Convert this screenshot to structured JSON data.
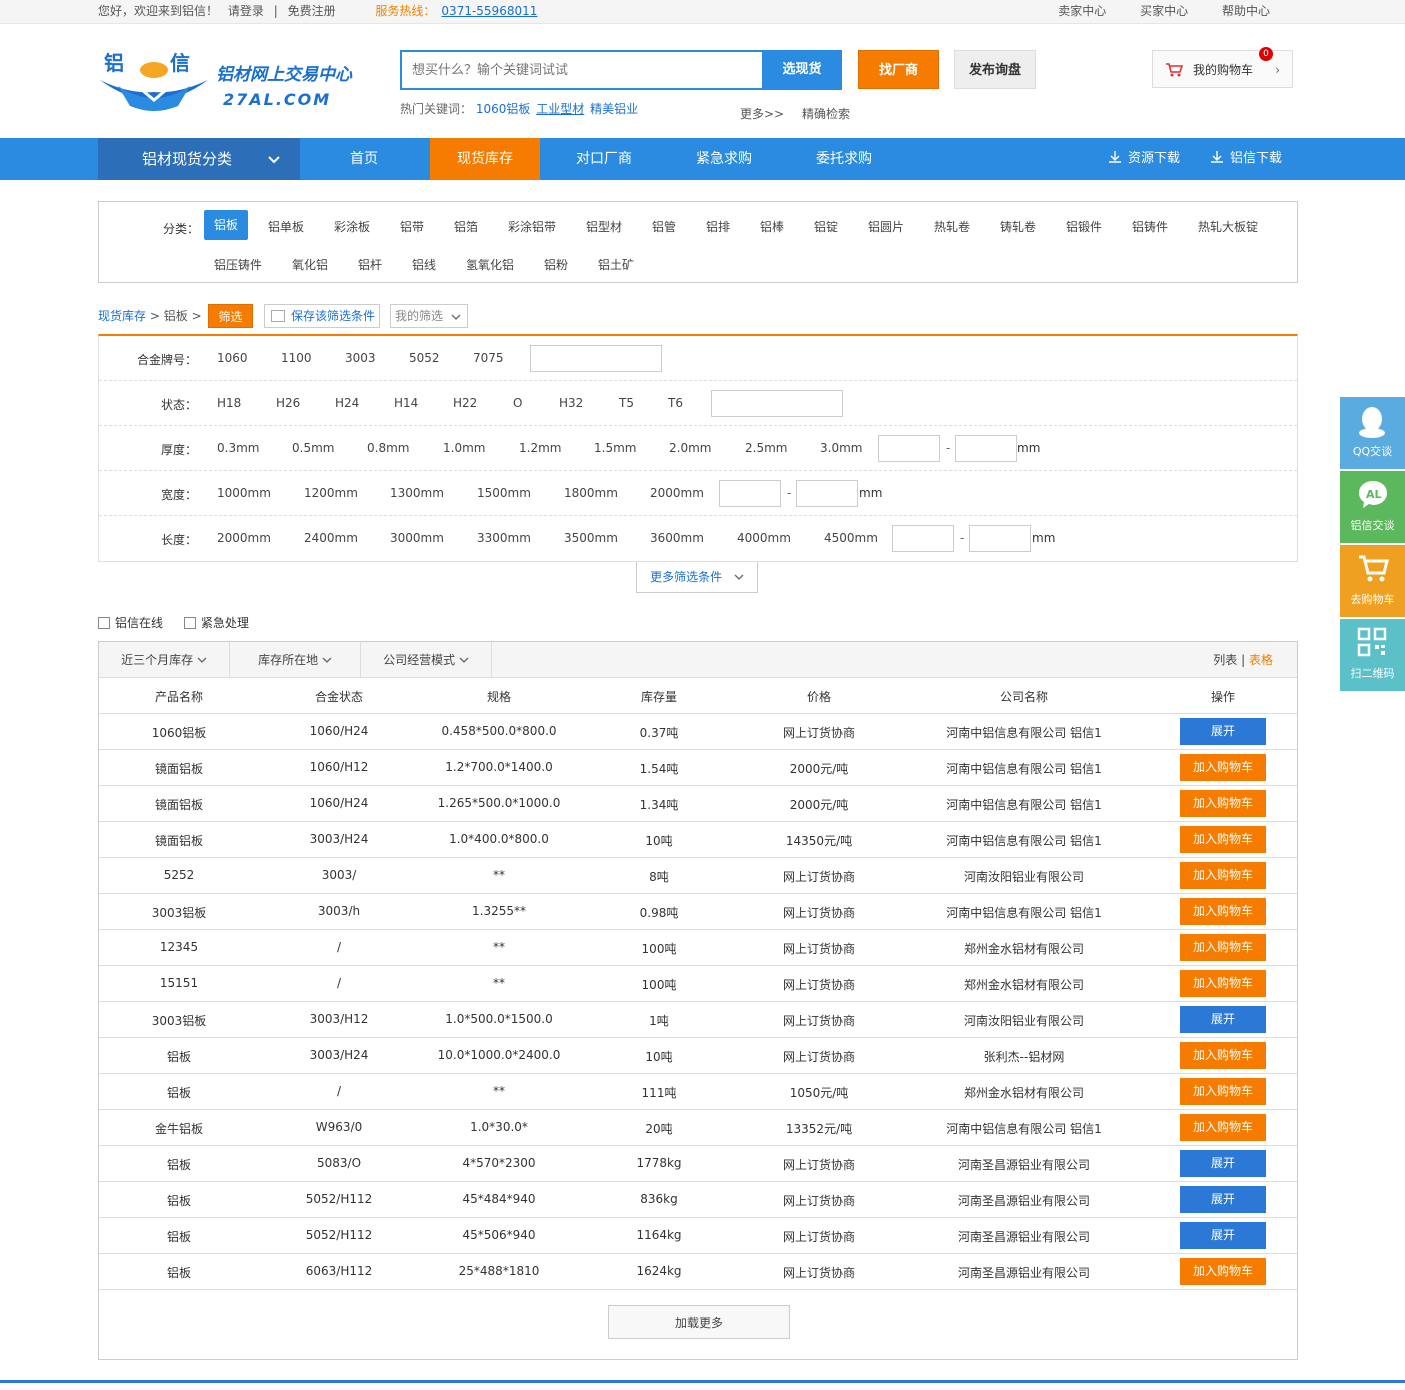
{
  "topbar": {
    "welcome": "您好，欢迎来到铝信！",
    "login": "请登录",
    "sep": "|",
    "register": "免费注册",
    "hotline_label": "服务热线：",
    "hotline": "0371-55968011",
    "seller": "卖家中心",
    "buyer": "买家中心",
    "help": "帮助中心"
  },
  "header": {
    "logo_cn_1": "铝",
    "logo_cn_2": "信",
    "logo_slogan": "铝材网上交易中心",
    "logo_domain": "27AL.COM",
    "search_placeholder": "想买什么？输个关键词试试",
    "search_btn": "选现货",
    "find_factory_btn": "找厂商",
    "publish_btn": "发布询盘",
    "hot_label": "热门关键词：",
    "hot_keywords": [
      "1060铝板",
      "工业型材",
      "精美铝业"
    ],
    "more": "更多>>",
    "exact": "精确检索",
    "cart_label": "我的购物车",
    "cart_count": "0",
    "cart_arrow": "›"
  },
  "nav": {
    "category": "铝材现货分类",
    "items": [
      "首页",
      "现货库存",
      "对口厂商",
      "紧急求购",
      "委托求购"
    ],
    "active": "现货库存",
    "downloads": [
      "资源下载",
      "铝信下载"
    ]
  },
  "categories": {
    "label": "分类：",
    "row1": [
      "铝板",
      "铝单板",
      "彩涂板",
      "铝带",
      "铝箔",
      "彩涂铝带",
      "铝型材",
      "铝管",
      "铝排",
      "铝棒",
      "铝锭",
      "铝圆片",
      "热轧卷",
      "铸轧卷",
      "铝锻件",
      "铝铸件",
      "热轧大板锭"
    ],
    "row2": [
      "铝压铸件",
      "氧化铝",
      "铝杆",
      "铝线",
      "氢氧化铝",
      "铝粉",
      "铝土矿"
    ],
    "active": "铝板"
  },
  "crumb": {
    "root": "现货库存",
    "arrow1": ">",
    "current": "铝板",
    "arrow2": ">",
    "filter_btn": "筛选",
    "save_btn": "保存该筛选条件",
    "mine": "我的筛选"
  },
  "filters": {
    "alloy": {
      "label": "合金牌号：",
      "options": [
        "1060",
        "1100",
        "3003",
        "5052",
        "7075"
      ]
    },
    "state": {
      "label": "状态：",
      "options": [
        "H18",
        "H26",
        "H24",
        "H14",
        "H22",
        "O",
        "H32",
        "T5",
        "T6"
      ]
    },
    "thickness": {
      "label": "厚度：",
      "options": [
        "0.3mm",
        "0.5mm",
        "0.8mm",
        "1.0mm",
        "1.2mm",
        "1.5mm",
        "2.0mm",
        "2.5mm",
        "3.0mm"
      ],
      "unit": "mm"
    },
    "width": {
      "label": "宽度：",
      "options": [
        "1000mm",
        "1200mm",
        "1300mm",
        "1500mm",
        "1800mm",
        "2000mm"
      ],
      "unit": "mm"
    },
    "length": {
      "label": "长度：",
      "options": [
        "2000mm",
        "2400mm",
        "3000mm",
        "3300mm",
        "3500mm",
        "3600mm",
        "4000mm",
        "4500mm"
      ],
      "unit": "mm"
    },
    "range_sep": "-",
    "more": "更多筛选条件"
  },
  "checks": [
    "铝信在线",
    "紧急处理"
  ],
  "table": {
    "dropdowns": [
      "近三个月库存",
      "库存所在地",
      "公司经营模式"
    ],
    "view_list": "列表",
    "view_sep": "|",
    "view_table": "表格",
    "headers": [
      "产品名称",
      "合金状态",
      "规格",
      "库存量",
      "价格",
      "公司名称",
      "操作"
    ],
    "rows": [
      {
        "name": "1060铝板",
        "alloy": "1060/H24",
        "spec": "0.458*500.0*800.0",
        "stock": "0.37吨",
        "price": "网上订货协商",
        "company": "河南中铝信息有限公司 铝信1",
        "action": "展开",
        "type": "blue"
      },
      {
        "name": "镜面铝板",
        "alloy": "1060/H12",
        "spec": "1.2*700.0*1400.0",
        "stock": "1.54吨",
        "price": "2000元/吨",
        "company": "河南中铝信息有限公司 铝信1",
        "action": "加入购物车",
        "type": "orange"
      },
      {
        "name": "镜面铝板",
        "alloy": "1060/H24",
        "spec": "1.265*500.0*1000.0",
        "stock": "1.34吨",
        "price": "2000元/吨",
        "company": "河南中铝信息有限公司 铝信1",
        "action": "加入购物车",
        "type": "orange"
      },
      {
        "name": "镜面铝板",
        "alloy": "3003/H24",
        "spec": "1.0*400.0*800.0",
        "stock": "10吨",
        "price": "14350元/吨",
        "company": "河南中铝信息有限公司 铝信1",
        "action": "加入购物车",
        "type": "orange"
      },
      {
        "name": "5252",
        "alloy": "3003/",
        "spec": "**",
        "stock": "8吨",
        "price": "网上订货协商",
        "company": "河南汝阳铝业有限公司",
        "action": "加入购物车",
        "type": "orange"
      },
      {
        "name": "3003铝板",
        "alloy": "3003/h",
        "spec": "1.3255**",
        "stock": "0.98吨",
        "price": "网上订货协商",
        "company": "河南中铝信息有限公司 铝信1",
        "action": "加入购物车",
        "type": "orange"
      },
      {
        "name": "12345",
        "alloy": "/",
        "spec": "**",
        "stock": "100吨",
        "price": "网上订货协商",
        "company": "郑州金水铝材有限公司",
        "action": "加入购物车",
        "type": "orange"
      },
      {
        "name": "15151",
        "alloy": "/",
        "spec": "**",
        "stock": "100吨",
        "price": "网上订货协商",
        "company": "郑州金水铝材有限公司",
        "action": "加入购物车",
        "type": "orange"
      },
      {
        "name": "3003铝板",
        "alloy": "3003/H12",
        "spec": "1.0*500.0*1500.0",
        "stock": "1吨",
        "price": "网上订货协商",
        "company": "河南汝阳铝业有限公司",
        "action": "展开",
        "type": "blue"
      },
      {
        "name": "铝板",
        "alloy": "3003/H24",
        "spec": "10.0*1000.0*2400.0",
        "stock": "10吨",
        "price": "网上订货协商",
        "company": "张利杰--铝材网",
        "action": "加入购物车",
        "type": "orange"
      },
      {
        "name": "铝板",
        "alloy": "/",
        "spec": "**",
        "stock": "111吨",
        "price": "1050元/吨",
        "company": "郑州金水铝材有限公司",
        "action": "加入购物车",
        "type": "orange"
      },
      {
        "name": "金牛铝板",
        "alloy": "W963/0",
        "spec": "1.0*30.0*",
        "stock": "20吨",
        "price": "13352元/吨",
        "company": "河南中铝信息有限公司 铝信1",
        "action": "加入购物车",
        "type": "orange"
      },
      {
        "name": "铝板",
        "alloy": "5083/O",
        "spec": "4*570*2300",
        "stock": "1778kg",
        "price": "网上订货协商",
        "company": "河南圣昌源铝业有限公司",
        "action": "展开",
        "type": "blue"
      },
      {
        "name": "铝板",
        "alloy": "5052/H112",
        "spec": "45*484*940",
        "stock": "836kg",
        "price": "网上订货协商",
        "company": "河南圣昌源铝业有限公司",
        "action": "展开",
        "type": "blue"
      },
      {
        "name": "铝板",
        "alloy": "5052/H112",
        "spec": "45*506*940",
        "stock": "1164kg",
        "price": "网上订货协商",
        "company": "河南圣昌源铝业有限公司",
        "action": "展开",
        "type": "blue"
      },
      {
        "name": "铝板",
        "alloy": "6063/H112",
        "spec": "25*488*1810",
        "stock": "1624kg",
        "price": "网上订货协商",
        "company": "河南圣昌源铝业有限公司",
        "action": "加入购物车",
        "type": "orange"
      }
    ],
    "load_more": "加载更多"
  },
  "sidebar": [
    {
      "label": "QQ交谈",
      "icon": "qq-icon",
      "color": "#5aabe0"
    },
    {
      "label": "铝信交谈",
      "icon": "chat-icon",
      "color": "#5cb85c"
    },
    {
      "label": "去购物车",
      "icon": "cart-icon",
      "color": "#f0a020"
    },
    {
      "label": "扫二维码",
      "icon": "qrcode-icon",
      "color": "#5bc0c8"
    }
  ]
}
